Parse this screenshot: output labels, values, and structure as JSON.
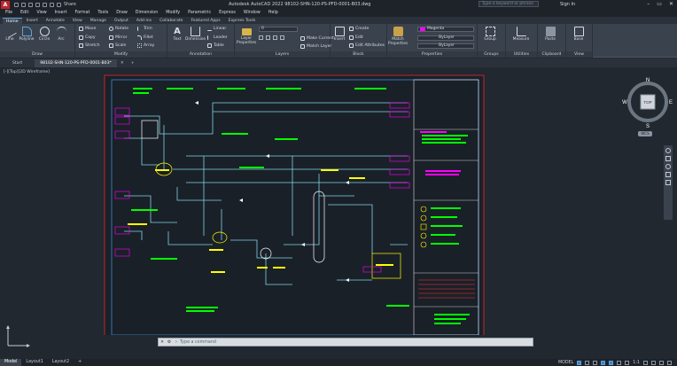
{
  "app": {
    "title": "Autodesk AutoCAD 2022   98102-SHN-120-PS-PFD-0001-B03.dwg",
    "logo": "A",
    "share": "Share",
    "search_placeholder": "Type a keyword or phrase",
    "signin": "Sign In"
  },
  "menu": [
    "File",
    "Edit",
    "View",
    "Insert",
    "Format",
    "Tools",
    "Draw",
    "Dimension",
    "Modify",
    "Parametric",
    "Express",
    "Window",
    "Help"
  ],
  "ribbon_tabs": [
    "Home",
    "Insert",
    "Annotate",
    "View",
    "Manage",
    "Output",
    "Add-ins",
    "Collaborate",
    "Featured Apps",
    "Express Tools"
  ],
  "ribbon": {
    "draw": {
      "title": "Draw",
      "line": "Line",
      "polyline": "Polyline",
      "circle": "Circle",
      "arc": "Arc"
    },
    "modify": {
      "title": "Modify",
      "move": "Move",
      "rotate": "Rotate",
      "trim": "Trim",
      "copy": "Copy",
      "mirror": "Mirror",
      "fillet": "Fillet",
      "stretch": "Stretch",
      "scale": "Scale",
      "array": "Array"
    },
    "annotation": {
      "title": "Annotation",
      "text": "Text",
      "dimension": "Dimension",
      "linear": "Linear",
      "leader": "Leader",
      "table": "Table"
    },
    "layers": {
      "title": "Layers",
      "layer_properties": "Layer Properties",
      "current_layer": "0",
      "make_current": "Make Current",
      "match_layer": "Match Layer"
    },
    "block": {
      "title": "Block",
      "insert": "Insert",
      "create": "Create",
      "edit": "Edit",
      "edit_attributes": "Edit Attributes"
    },
    "properties": {
      "title": "Properties",
      "match_properties": "Match Properties",
      "color": "Magenta",
      "linetype": "ByLayer",
      "lineweight": "ByLayer"
    },
    "groups": {
      "title": "Groups",
      "group": "Group"
    },
    "utilities": {
      "title": "Utilities",
      "measure": "Measure"
    },
    "clipboard": {
      "title": "Clipboard",
      "paste": "Paste"
    },
    "view": {
      "title": "View",
      "base": "Base"
    }
  },
  "doc_tabs": [
    "Start",
    "98102-SHN-120-PS-PFD-0001-B03*"
  ],
  "viewport_label": "[-][Top][2D Wireframe]",
  "viewcube": {
    "face": "TOP",
    "n": "N",
    "s": "S",
    "e": "E",
    "w": "W",
    "ucs": "WCS"
  },
  "command": {
    "placeholder": "Type a command"
  },
  "layout_tabs": [
    "Model",
    "Layout1",
    "Layout2"
  ],
  "status": {
    "mode": "MODEL",
    "scale": "1:1"
  },
  "colors": {
    "accent": "#5fa3e0",
    "magenta": "#ff00ff",
    "drawing_bg": "#1a2028",
    "frame": "#c0262d",
    "pipe": "#7fd4e6",
    "text_green": "#00ff00",
    "text_yellow": "#ffff00",
    "text_white": "#ffffff"
  }
}
